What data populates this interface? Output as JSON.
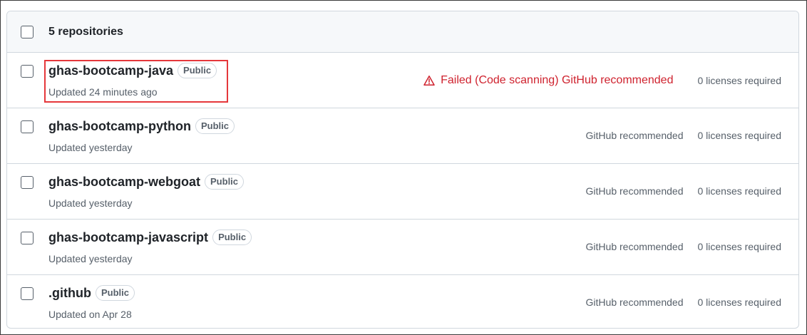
{
  "header": {
    "count_label": "5 repositories"
  },
  "colors": {
    "failed": "#cf222e",
    "highlight": "#e5373b",
    "muted": "#57606a"
  },
  "repositories": [
    {
      "name": "ghas-bootcamp-java",
      "visibility": "Public",
      "updated": "Updated 24 minutes ago",
      "status": "Failed (Code scanning) GitHub recommended",
      "status_icon": "alert-triangle-icon",
      "licenses": "0 licenses required"
    },
    {
      "name": "ghas-bootcamp-python",
      "visibility": "Public",
      "updated": "Updated yesterday",
      "status": "GitHub recommended",
      "licenses": "0 licenses required"
    },
    {
      "name": "ghas-bootcamp-webgoat",
      "visibility": "Public",
      "updated": "Updated yesterday",
      "status": "GitHub recommended",
      "licenses": "0 licenses required"
    },
    {
      "name": "ghas-bootcamp-javascript",
      "visibility": "Public",
      "updated": "Updated yesterday",
      "status": "GitHub recommended",
      "licenses": "0 licenses required"
    },
    {
      "name": ".github",
      "visibility": "Public",
      "updated": "Updated on Apr 28",
      "status": "GitHub recommended",
      "licenses": "0 licenses required"
    }
  ]
}
